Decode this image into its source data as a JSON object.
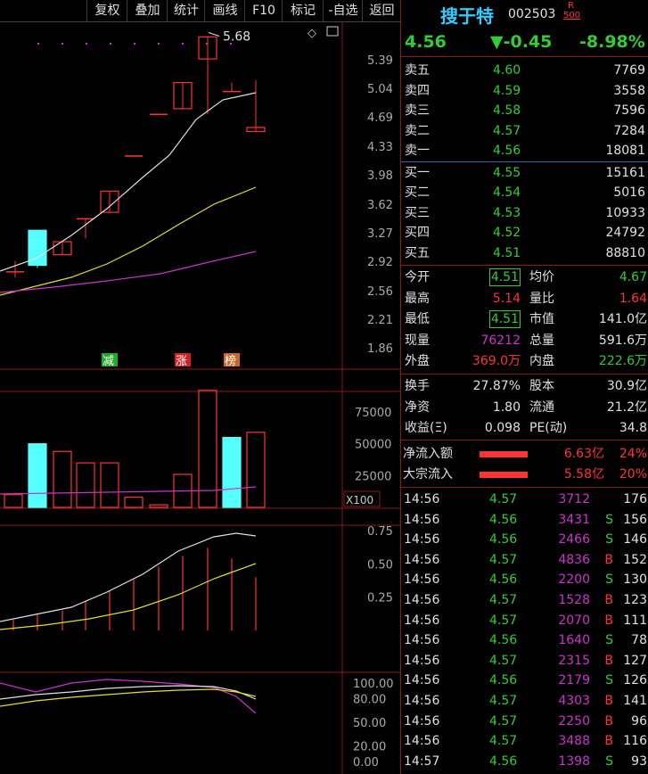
{
  "toolbar": [
    "复权",
    "叠加",
    "统计",
    "画线",
    "F10",
    "标记",
    "-自选",
    "返回"
  ],
  "stock": {
    "name": "搜于特",
    "code": "002503",
    "r_badge": "R",
    "r_num": "500",
    "price": "4.56",
    "change": "▼-0.45",
    "pct": "-8.98%"
  },
  "order_book": [
    {
      "label": "卖五",
      "price": "4.60",
      "vol": "7769"
    },
    {
      "label": "卖四",
      "price": "4.59",
      "vol": "3558"
    },
    {
      "label": "卖三",
      "price": "4.58",
      "vol": "7596"
    },
    {
      "label": "卖二",
      "price": "4.57",
      "vol": "7284"
    },
    {
      "label": "卖一",
      "price": "4.56",
      "vol": "18081"
    },
    {
      "label": "买一",
      "price": "4.55",
      "vol": "15161"
    },
    {
      "label": "买二",
      "price": "4.54",
      "vol": "5016"
    },
    {
      "label": "买三",
      "price": "4.53",
      "vol": "10933"
    },
    {
      "label": "买四",
      "price": "4.52",
      "vol": "24792"
    },
    {
      "label": "买五",
      "price": "4.51",
      "vol": "88810"
    }
  ],
  "stats1": [
    {
      "l1": "今开",
      "v1": "4.51",
      "l2": "均价",
      "v2": "4.67"
    },
    {
      "l1": "最高",
      "v1": "5.14",
      "l2": "量比",
      "v2": "1.64"
    },
    {
      "l1": "最低",
      "v1": "4.51",
      "l2": "市值",
      "v2": "141.0亿"
    },
    {
      "l1": "现量",
      "v1": "76212",
      "l2": "总量",
      "v2": "591.6万"
    },
    {
      "l1": "外盘",
      "v1": "369.0万",
      "l2": "内盘",
      "v2": "222.6万"
    }
  ],
  "stats2": [
    {
      "l1": "换手",
      "v1": "27.87%",
      "l2": "股本",
      "v2": "30.9亿"
    },
    {
      "l1": "净资",
      "v1": "1.80",
      "l2": "流通",
      "v2": "21.2亿"
    },
    {
      "l1": "收益(Ξ)",
      "v1": "0.098",
      "l2": "PE(动)",
      "v2": "34.8"
    }
  ],
  "flows": [
    {
      "label": "净流入额",
      "value": "6.63亿",
      "pct": "24%"
    },
    {
      "label": "大宗流入",
      "value": "5.58亿",
      "pct": "20%"
    }
  ],
  "ticks": [
    {
      "t": "14:56",
      "p": "4.57",
      "v": "3712",
      "s": "",
      "n": "176"
    },
    {
      "t": "14:56",
      "p": "4.56",
      "v": "3431",
      "s": "S",
      "n": "156"
    },
    {
      "t": "14:56",
      "p": "4.56",
      "v": "2466",
      "s": "S",
      "n": "146"
    },
    {
      "t": "14:56",
      "p": "4.57",
      "v": "4836",
      "s": "B",
      "n": "152"
    },
    {
      "t": "14:56",
      "p": "4.56",
      "v": "2200",
      "s": "S",
      "n": "130"
    },
    {
      "t": "14:56",
      "p": "4.57",
      "v": "1528",
      "s": "B",
      "n": "123"
    },
    {
      "t": "14:56",
      "p": "4.57",
      "v": "2070",
      "s": "B",
      "n": "111"
    },
    {
      "t": "14:56",
      "p": "4.56",
      "v": "1640",
      "s": "S",
      "n": "78"
    },
    {
      "t": "14:56",
      "p": "4.57",
      "v": "2315",
      "s": "B",
      "n": "127"
    },
    {
      "t": "14:56",
      "p": "4.56",
      "v": "2179",
      "s": "S",
      "n": "126"
    },
    {
      "t": "14:56",
      "p": "4.57",
      "v": "4303",
      "s": "B",
      "n": "141"
    },
    {
      "t": "14:56",
      "p": "4.57",
      "v": "2250",
      "s": "B",
      "n": "96"
    },
    {
      "t": "14:56",
      "p": "4.57",
      "v": "3488",
      "s": "B",
      "n": "116"
    },
    {
      "t": "14:57",
      "p": "4.56",
      "v": "1398",
      "s": "S",
      "n": "93"
    }
  ],
  "chart": {
    "price_axis": [
      "5.39",
      "5.04",
      "4.69",
      "4.33",
      "3.98",
      "3.62",
      "3.27",
      "2.92",
      "2.56",
      "2.21",
      "1.86"
    ],
    "high_label": "5.68",
    "vol_axis": [
      "75000",
      "50000",
      "25000"
    ],
    "vol_unit": "X100",
    "ind1_axis": [
      "0.75",
      "0.50",
      "0.25"
    ],
    "ind2_axis": [
      "100.00",
      "80.00",
      "50.00",
      "20.00",
      "0.00"
    ],
    "badges": [
      {
        "text": "减",
        "color": "#22aa22"
      },
      {
        "text": "涨",
        "color": "#cc2222"
      },
      {
        "text": "榜",
        "color": "#cc6622"
      }
    ],
    "colors": {
      "up": "#ff3333",
      "down": "#55ffff",
      "ma1": "#e0e0e0",
      "ma2": "#e0e030",
      "ma3": "#cc33cc",
      "grid": "#8a1a1a"
    }
  }
}
